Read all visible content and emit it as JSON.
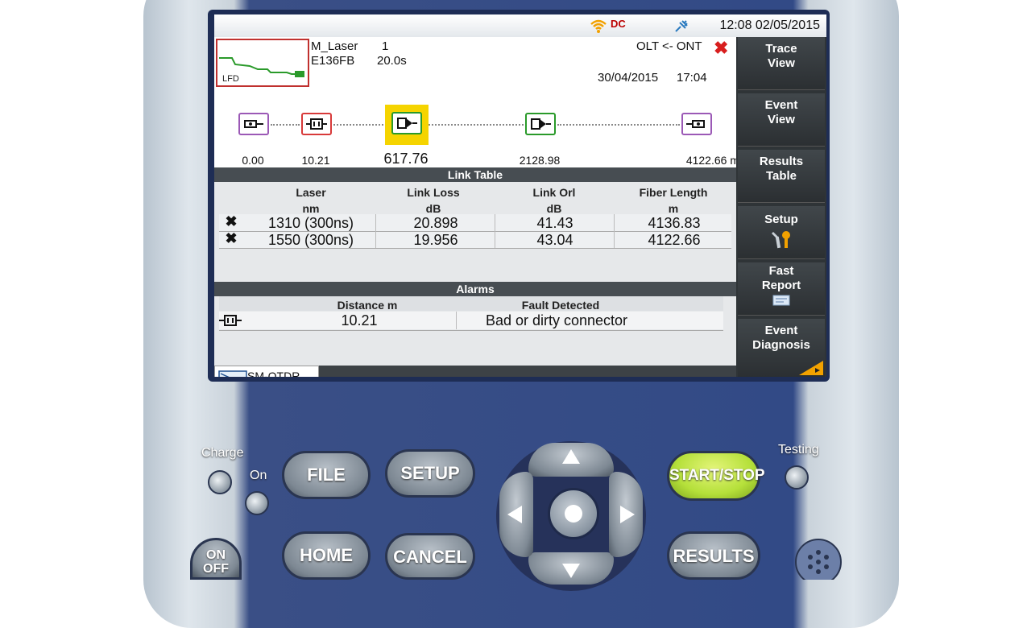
{
  "status": {
    "time": "12:08 02/05/2015"
  },
  "header": {
    "thumb_label": "LFD",
    "laser_name": "M_Laser",
    "laser_index": "1",
    "file_id": "E136FB",
    "duration": "20.0s",
    "direction": "OLT <- ONT",
    "status_mark": "✖",
    "trace_date": "30/04/2015",
    "trace_time": "17:04"
  },
  "link_map": {
    "distances": [
      "0.00",
      "10.21",
      "617.76",
      "2128.98",
      "4122.66 m"
    ]
  },
  "link_table": {
    "title": "Link Table",
    "headers": [
      {
        "name": "Laser",
        "unit": "nm"
      },
      {
        "name": "Link Loss",
        "unit": "dB"
      },
      {
        "name": "Link Orl",
        "unit": "dB"
      },
      {
        "name": "Fiber Length",
        "unit": "m"
      }
    ],
    "rows": [
      {
        "mark": "✖",
        "laser": "1310 (300ns)",
        "loss": "20.898",
        "orl": "41.43",
        "length": "4136.83"
      },
      {
        "mark": "✖",
        "laser": "1550 (300ns)",
        "loss": "19.956",
        "orl": "43.04",
        "length": "4122.66"
      }
    ]
  },
  "alarms": {
    "title": "Alarms",
    "headers": {
      "distance": "Distance m",
      "fault": "Fault Detected"
    },
    "rows": [
      {
        "distance": "10.21",
        "fault": "Bad or dirty connector"
      }
    ]
  },
  "tab": {
    "label": "SM-OTDR"
  },
  "sidebar": {
    "items": [
      {
        "line1": "Trace",
        "line2": "View"
      },
      {
        "line1": "Event",
        "line2": "View"
      },
      {
        "line1": "Results",
        "line2": "Table"
      },
      {
        "line1": "Setup",
        "line2": ""
      },
      {
        "line1": "Fast",
        "line2": "Report"
      },
      {
        "line1": "Event",
        "line2": "Diagnosis"
      }
    ]
  },
  "keys": {
    "file": "FILE",
    "setup": "SETUP",
    "start_stop": "START/STOP",
    "home": "HOME",
    "cancel": "CANCEL",
    "results": "RESULTS",
    "on_off_1": "ON",
    "on_off_2": "OFF"
  },
  "labels": {
    "charge": "Charge",
    "on": "On",
    "testing": "Testing"
  },
  "colors": {
    "alert_red": "#d81e1e",
    "start_key": "#b5e03a",
    "highlight": "#f5d400"
  }
}
